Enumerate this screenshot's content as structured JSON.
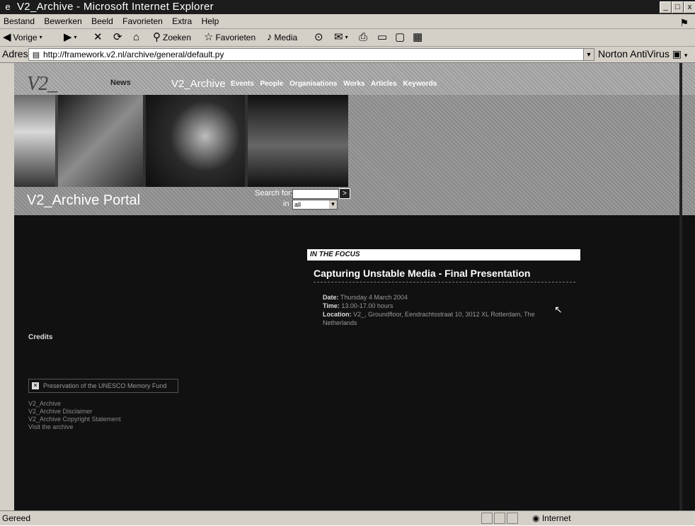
{
  "window": {
    "title": "V2_Archive - Microsoft Internet Explorer",
    "controls": [
      "_",
      "□",
      "x"
    ]
  },
  "menu": {
    "items": [
      "Bestand",
      "Bewerken",
      "Beeld",
      "Favorieten",
      "Extra",
      "Help"
    ]
  },
  "toolbar": {
    "back": "Vorige",
    "search": "Zoeken",
    "favorites": "Favorieten",
    "media": "Media"
  },
  "address": {
    "label": "Adres",
    "url": "http://framework.v2.nl/archive/general/default.py",
    "norton": "Norton AntiVirus"
  },
  "site": {
    "logo": "V2_",
    "news": "News",
    "name": "V2_Archive",
    "nav": [
      "Events",
      "People",
      "Organisations",
      "Works",
      "Articles",
      "Keywords"
    ],
    "portal_title": "V2_Archive Portal",
    "search_label": "Search for:",
    "search_go": ">",
    "in_label": "in",
    "in_value": "all"
  },
  "left": {
    "credits_heading": "Credits",
    "unesco_link": "Preservation of the UNESCO Memory Fund",
    "links": [
      "V2_Archive",
      "V2_Archive Disclaimer",
      "V2_Archive Copyright Statement",
      "Visit the archive"
    ]
  },
  "focus": {
    "heading": "IN THE FOCUS",
    "title": "Capturing Unstable Media - Final Presentation",
    "date_label": "Date:",
    "date": "Thursday 4 March 2004",
    "time_label": "Time:",
    "time": "13.00-17.00 hours",
    "location_label": "Location:",
    "location": "V2_, Groundfloor, Eendrachtsstraat 10, 3012 XL Rotterdam, The Netherlands"
  },
  "status": {
    "left": "Gereed",
    "zone": "Internet"
  },
  "colors": {
    "titlebar": "#1c1c1c",
    "chrome": "#d4d0c8",
    "page_bg": "#111111"
  }
}
